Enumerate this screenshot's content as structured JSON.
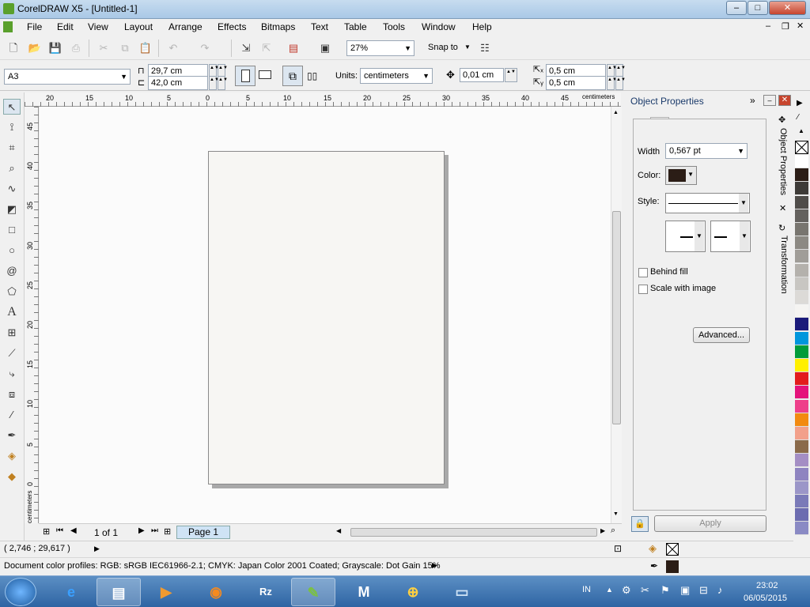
{
  "window": {
    "title": "CorelDRAW X5 - [Untitled-1]",
    "min": "–",
    "max": "□",
    "close": "✕"
  },
  "menu": [
    "File",
    "Edit",
    "View",
    "Layout",
    "Arrange",
    "Effects",
    "Bitmaps",
    "Text",
    "Table",
    "Tools",
    "Window",
    "Help"
  ],
  "toolbar1": {
    "zoom": "27%",
    "snap_to": "Snap to"
  },
  "toolbar2": {
    "paper": "A3",
    "width": "29,7 cm",
    "height": "42,0 cm",
    "units_label": "Units:",
    "units": "centimeters",
    "nudge": "0,01 cm",
    "dup_x": "0,5 cm",
    "dup_y": "0,5 cm"
  },
  "ruler": {
    "h_labels": [
      "20",
      "15",
      "10",
      "5",
      "0",
      "5",
      "10",
      "15",
      "20",
      "25",
      "30",
      "35",
      "40",
      "45"
    ],
    "h_unit": "centimeters",
    "v_labels": [
      "45",
      "40",
      "35",
      "30",
      "25",
      "20",
      "15",
      "10",
      "5",
      "0"
    ],
    "v_unit": "centimeters"
  },
  "pager": {
    "count": "1 of 1",
    "tab": "Page 1"
  },
  "status": {
    "coords": "( 2,746 ; 29,617 )",
    "profiles": "Document color profiles: RGB: sRGB IEC61966-2.1; CMYK: Japan Color 2001 Coated; Grayscale: Dot Gain 15%"
  },
  "docker": {
    "title": "Object Properties",
    "width_label": "Width",
    "width_value": "0,567 pt",
    "color_label": "Color:",
    "color_value": "#2b1d16",
    "style_label": "Style:",
    "behind_fill": "Behind fill",
    "scale_with_image": "Scale with image",
    "advanced": "Advanced...",
    "apply": "Apply",
    "tab_object_properties": "Object Properties",
    "tab_transformation": "Transformation"
  },
  "palette": [
    "#ffffff",
    "#2b1d16",
    "#3d3a37",
    "#4f4c49",
    "#64615e",
    "#78756f",
    "#8c8983",
    "#a09d98",
    "#b4b1ac",
    "#c8c6c2",
    "#dcdad7",
    "#f5f4f2",
    "#1a1a7a",
    "#0096dc",
    "#009c3a",
    "#fff000",
    "#e31c1c",
    "#e4127b",
    "#ee3f8a",
    "#f28a10",
    "#f2a08a",
    "#8a6a4a",
    "#a48ec4",
    "#8e84c0",
    "#9b96c8",
    "#7a7ab8",
    "#6c6cb0",
    "#8a8ac4"
  ],
  "taskbar": {
    "lang": "IN",
    "time": "23:02",
    "date": "06/05/2015"
  }
}
